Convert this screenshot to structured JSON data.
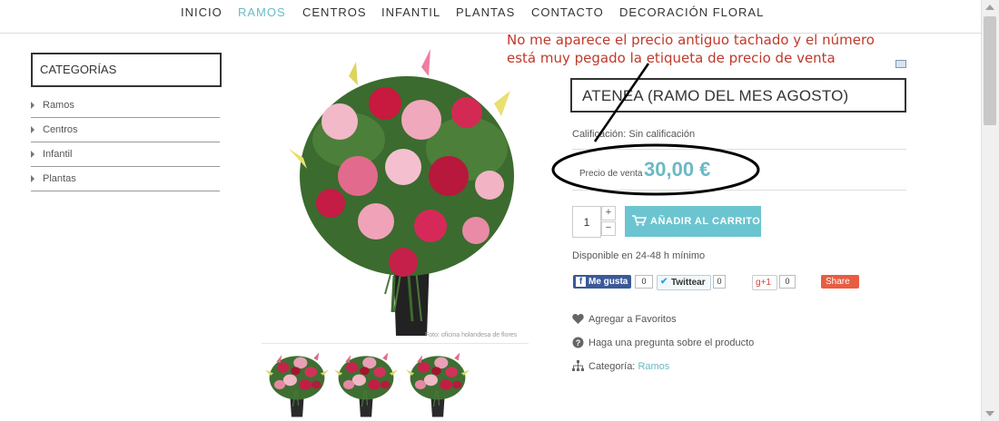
{
  "nav": {
    "items": [
      {
        "label": "INICIO",
        "active": false
      },
      {
        "label": "RAMOS",
        "active": true
      },
      {
        "label": "CENTROS",
        "active": false
      },
      {
        "label": "INFANTIL",
        "active": false
      },
      {
        "label": "PLANTAS",
        "active": false
      },
      {
        "label": "CONTACTO",
        "active": false
      },
      {
        "label": "DECORACIÓN FLORAL",
        "active": false
      }
    ]
  },
  "sidebar": {
    "title": "CATEGORÍAS",
    "items": [
      {
        "label": "Ramos"
      },
      {
        "label": "Centros"
      },
      {
        "label": "Infantil"
      },
      {
        "label": "Plantas"
      }
    ]
  },
  "image": {
    "caption": "Foto: oficina holandesa de flores"
  },
  "annotation": {
    "line1": "No me aparece el precio antiguo tachado y  el número",
    "line2": "está muy pegado la etiqueta de precio de venta"
  },
  "product": {
    "title": "ATENEA (RAMO DEL MES AGOSTO)",
    "rating": "Calificación: Sin calificación",
    "price_label": "Precio de venta",
    "price": "30,00 €",
    "quantity": "1",
    "plus": "+",
    "minus": "−",
    "add_to_cart": "AÑADIR AL CARRITO",
    "availability": "Disponible en 24-48 h mínimo"
  },
  "social": {
    "facebook_label": "Me gusta",
    "facebook_count": "0",
    "twitter_label": "Twittear",
    "twitter_count": "0",
    "gplus_label": "+1",
    "gplus_count": "0",
    "share_label": "Share"
  },
  "actions": {
    "favorites": "Agregar a Favoritos",
    "question": "Haga una pregunta sobre el producto",
    "category_label": "Categoría:",
    "category_value": "Ramos"
  },
  "colors": {
    "accent": "#6bb9c4",
    "cart_button": "#6bc5d0",
    "annotation": "#c0392b"
  },
  "icons": [
    "cart-icon",
    "heart-icon",
    "question-icon",
    "sitemap-icon",
    "mail-icon",
    "facebook-icon",
    "twitter-icon"
  ]
}
